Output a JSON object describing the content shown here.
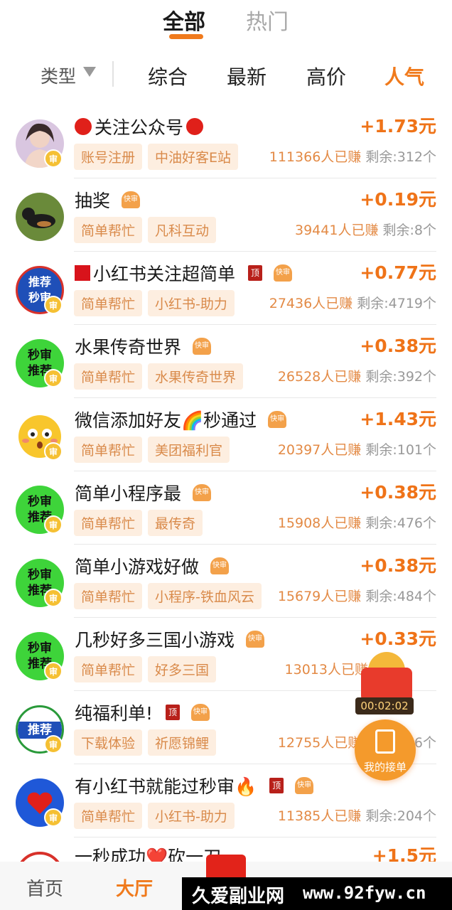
{
  "top_tabs": {
    "all": "全部",
    "hot": "热门"
  },
  "filter": {
    "type_label": "类型",
    "sorts": [
      "综合",
      "最新",
      "高价",
      "人气"
    ],
    "active_sort": "人气"
  },
  "tasks": [
    {
      "title": "关注公众号",
      "prefix": "red-dot",
      "suffix": "red-dot",
      "amount": "+1.73元",
      "tags": [
        "账号注册",
        "中油好客E站"
      ],
      "earned": "111366人已赚",
      "remaining": "剩余:312个",
      "avatar": "woman-photo"
    },
    {
      "title": "抽奖",
      "amount": "+0.19元",
      "tags": [
        "简单帮忙",
        "凡科互动"
      ],
      "earned": "39441人已赚",
      "remaining": "剩余:8个",
      "avatar": "dog-photo",
      "fast": true
    },
    {
      "title": "小红书关注超简单",
      "prefix": "red-square",
      "amount": "+0.77元",
      "tags": [
        "简单帮忙",
        "小红书-助力"
      ],
      "earned": "27436人已赚",
      "remaining": "剩余:4719个",
      "avatar": "recommend-blue",
      "top": true,
      "fast": true
    },
    {
      "title": "水果传奇世界",
      "amount": "+0.38元",
      "tags": [
        "简单帮忙",
        "水果传奇世界"
      ],
      "earned": "26528人已赚",
      "remaining": "剩余:392个",
      "avatar": "green-second",
      "fast": true
    },
    {
      "title": "微信添加好友🌈秒通过",
      "amount": "+1.43元",
      "tags": [
        "简单帮忙",
        "美团福利官"
      ],
      "earned": "20397人已赚",
      "remaining": "剩余:101个",
      "avatar": "emoji-face",
      "fast": true
    },
    {
      "title": "简单小程序最",
      "amount": "+0.38元",
      "tags": [
        "简单帮忙",
        "最传奇"
      ],
      "earned": "15908人已赚",
      "remaining": "剩余:476个",
      "avatar": "green-second",
      "fast": true
    },
    {
      "title": "简单小游戏好做",
      "amount": "+0.38元",
      "tags": [
        "简单帮忙",
        "小程序-铁血风云"
      ],
      "earned": "15679人已赚",
      "remaining": "剩余:484个",
      "avatar": "green-second",
      "fast": true
    },
    {
      "title": "几秒好多三国小游戏",
      "amount": "+0.33元",
      "tags": [
        "简单帮忙",
        "好多三国"
      ],
      "earned": "13013人已赚",
      "remaining": "",
      "avatar": "green-second",
      "fast": true
    },
    {
      "title": "纯福利单!",
      "amount": "",
      "tags": [
        "下载体验",
        "祈愿锦鲤"
      ],
      "earned": "12755人已赚",
      "remaining": "剩余:776个",
      "avatar": "recommend-white",
      "top": true,
      "fast": true
    },
    {
      "title": "有小红书就能过秒审🔥",
      "amount": "",
      "tags": [
        "简单帮忙",
        "小红书-助力"
      ],
      "earned": "11385人已赚",
      "remaining": "剩余:204个",
      "avatar": "heart-blue",
      "top": true,
      "fast": true
    },
    {
      "title": "一秒成功❤️砍一刀",
      "amount": "+1.5元",
      "tags": [],
      "earned": "",
      "remaining": "",
      "avatar": "red-circle"
    }
  ],
  "badges": {
    "top": "顶",
    "fast": "快审",
    "verified": "审"
  },
  "avatar_text": {
    "recommend": "推荐",
    "second": "秒审",
    "second_review": "秒审",
    "recommend_short": "推荐"
  },
  "float": {
    "timer": "00:02:02",
    "my_orders": "我的接单"
  },
  "bottom_nav": {
    "home": "首页",
    "hall": "大厅"
  },
  "watermark": {
    "left": "久爱副业网",
    "right": "www.92fyw.cn"
  },
  "colors": {
    "accent": "#f07a1c",
    "amount": "#ef7318",
    "tag_bg": "#fdeee0"
  }
}
